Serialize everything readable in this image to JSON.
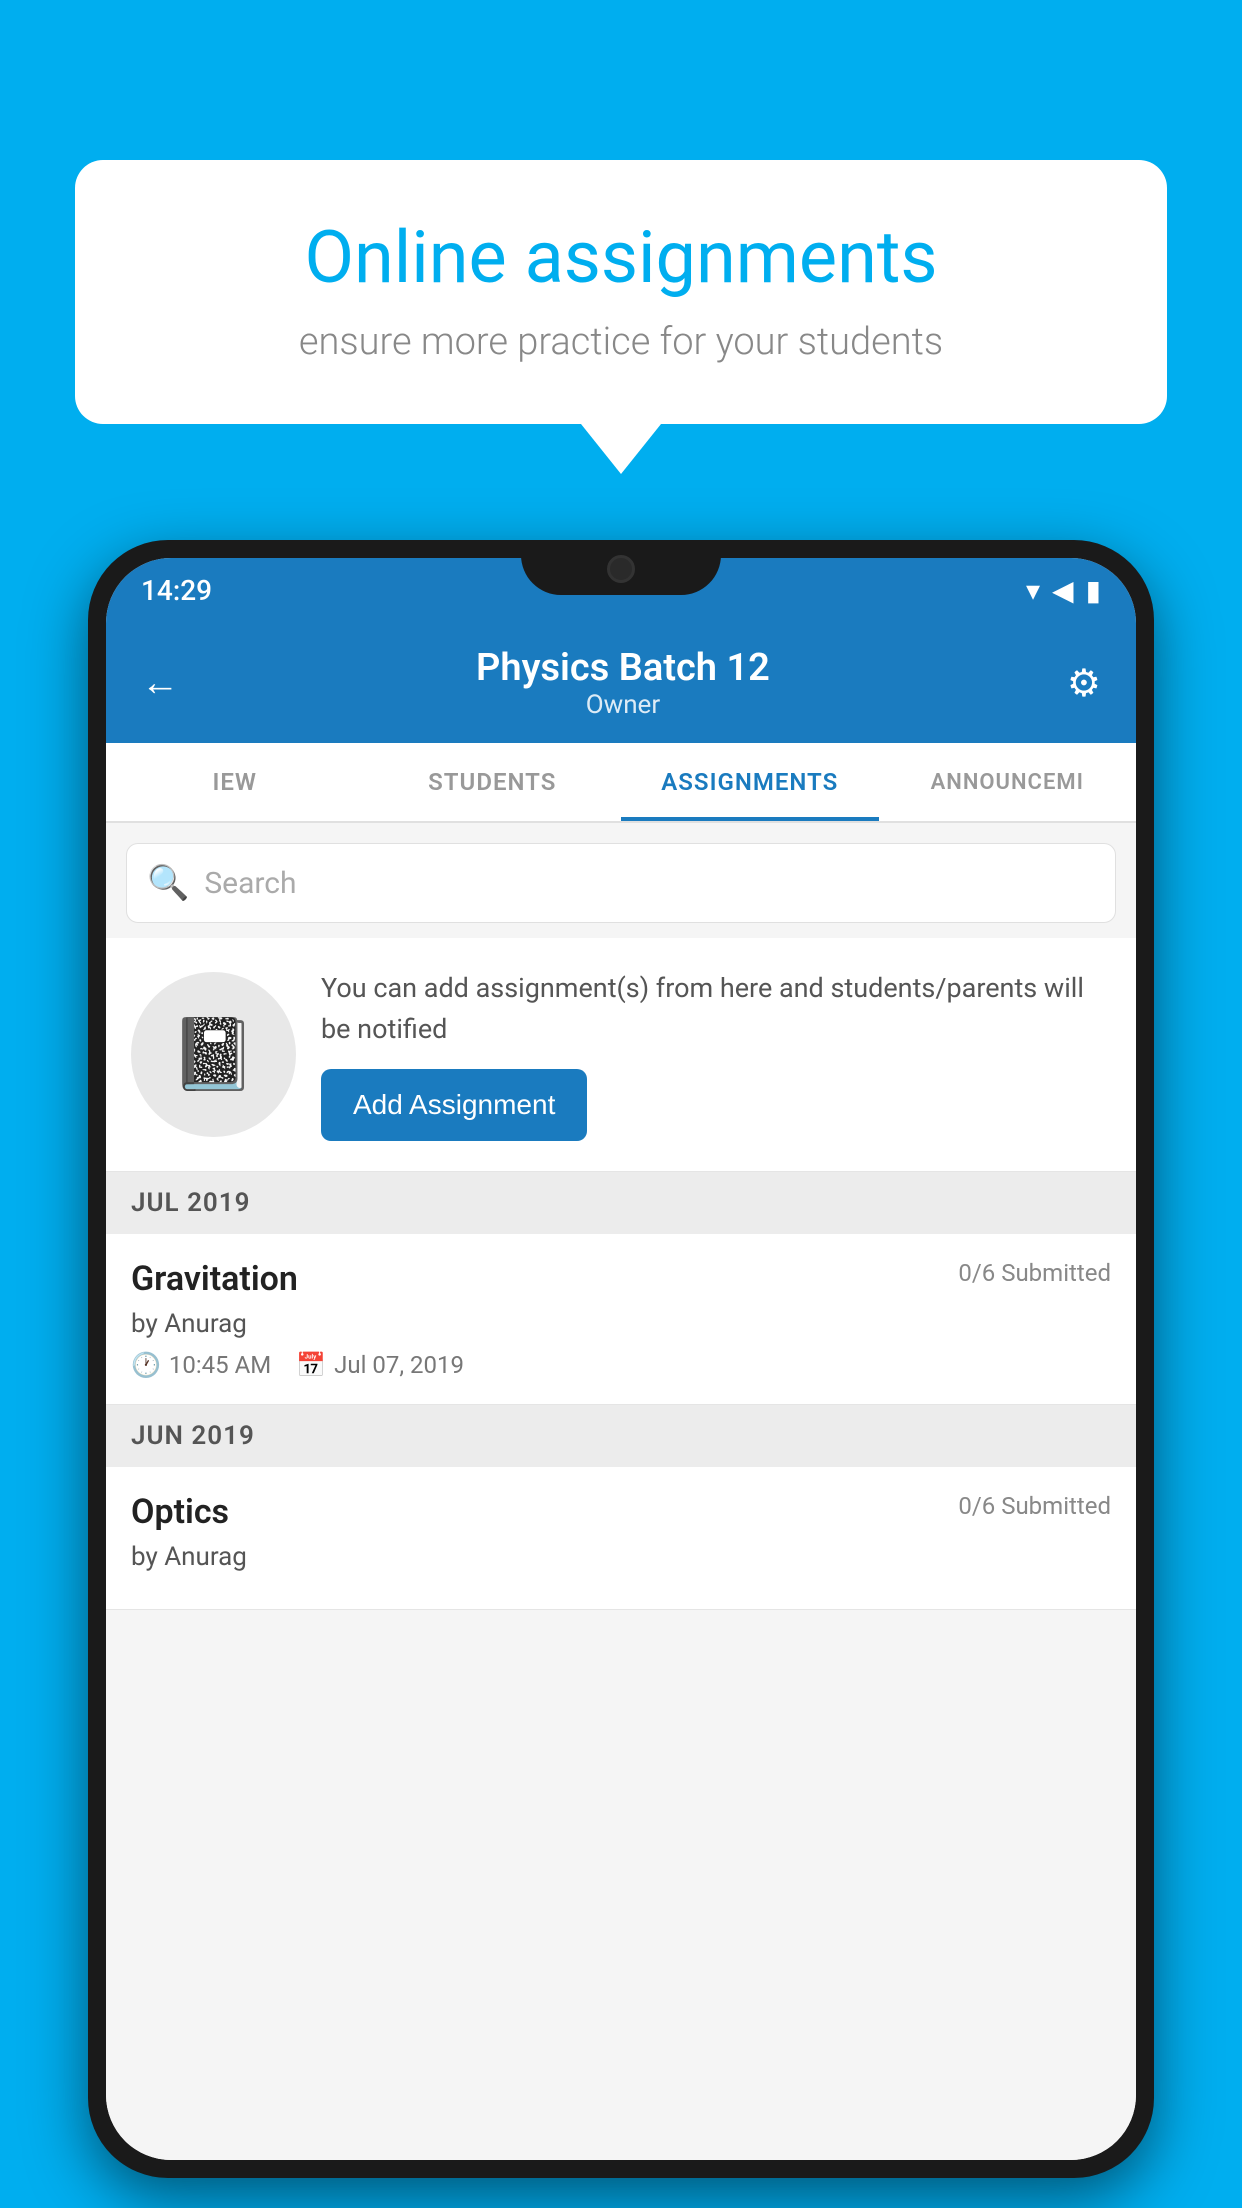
{
  "background_color": "#00AEEF",
  "speech_bubble": {
    "title": "Online assignments",
    "subtitle": "ensure more practice for your students"
  },
  "status_bar": {
    "time": "14:29",
    "signal": "▼◀▮"
  },
  "app_bar": {
    "back_label": "←",
    "title": "Physics Batch 12",
    "subtitle": "Owner",
    "settings_label": "⚙"
  },
  "tabs": [
    {
      "id": "review",
      "label": "IEW",
      "active": false
    },
    {
      "id": "students",
      "label": "STUDENTS",
      "active": false
    },
    {
      "id": "assignments",
      "label": "ASSIGNMENTS",
      "active": true
    },
    {
      "id": "announcements",
      "label": "ANNOUNCEMI",
      "active": false
    }
  ],
  "search": {
    "placeholder": "Search"
  },
  "promo": {
    "description": "You can add assignment(s) from here and students/parents will be notified",
    "button_label": "Add Assignment"
  },
  "sections": [
    {
      "header": "JUL 2019",
      "assignments": [
        {
          "name": "Gravitation",
          "submitted": "0/6 Submitted",
          "by": "by Anurag",
          "time": "10:45 AM",
          "date": "Jul 07, 2019"
        }
      ]
    },
    {
      "header": "JUN 2019",
      "assignments": [
        {
          "name": "Optics",
          "submitted": "0/6 Submitted",
          "by": "by Anurag",
          "time": "",
          "date": ""
        }
      ]
    }
  ]
}
